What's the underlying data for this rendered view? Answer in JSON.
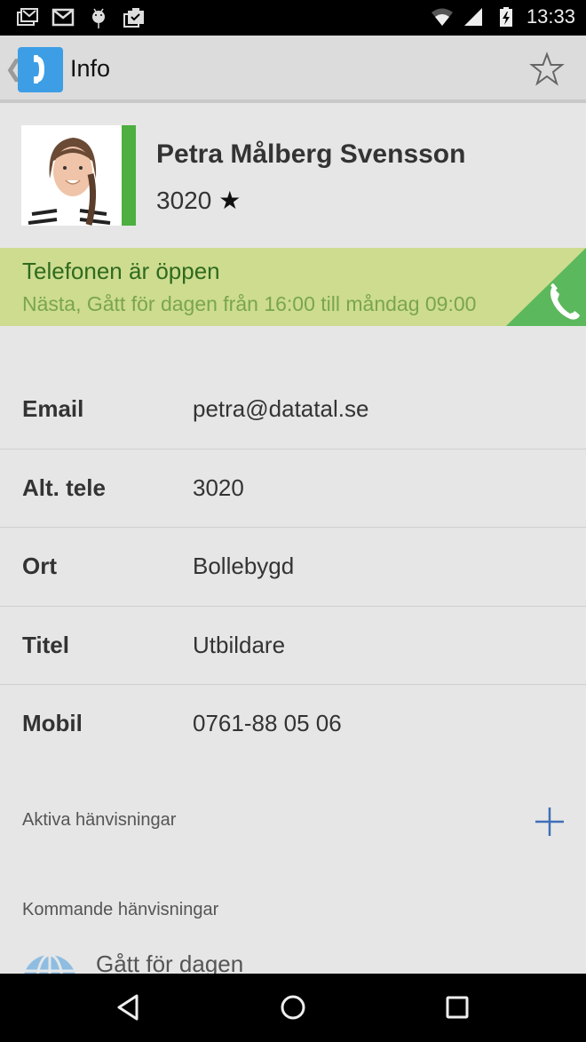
{
  "status_bar": {
    "notification_icons": [
      "gmail-stack-icon",
      "gmail-icon",
      "android-debug-icon",
      "clipboard-check-icon"
    ],
    "system_icons": [
      "wifi-icon",
      "cell-signal-icon",
      "battery-charging-icon"
    ],
    "time": "13:33"
  },
  "action_bar": {
    "back_glyph": "❮",
    "title": "Info",
    "favorite_icon": "star-outline-icon"
  },
  "profile": {
    "name": "Petra Målberg Svensson",
    "extension": "3020",
    "extension_star": "★",
    "status_color": "#4caf3f"
  },
  "banner": {
    "title": "Telefonen är öppen",
    "subtitle": "Nästa, Gått för dagen från 16:00 till måndag 09:00",
    "background": "#cddc8f",
    "accent": "#5cb85c",
    "icon": "phone-icon"
  },
  "fields": [
    {
      "label": "Email",
      "value": "petra@datatal.se"
    },
    {
      "label": "Alt. tele",
      "value": "3020"
    },
    {
      "label": "Ort",
      "value": "Bollebygd"
    },
    {
      "label": "Titel",
      "value": "Utbildare"
    },
    {
      "label": "Mobil",
      "value": "0761-88 05 06"
    }
  ],
  "sections": {
    "active": "Aktiva hänvisningar",
    "upcoming": "Kommande hänvisningar"
  },
  "upcoming_items": [
    {
      "icon": "globe-icon",
      "text": "Gått för dagen"
    }
  ],
  "nav_bar": {
    "back": "back-icon",
    "home": "home-icon",
    "recents": "recents-icon"
  }
}
